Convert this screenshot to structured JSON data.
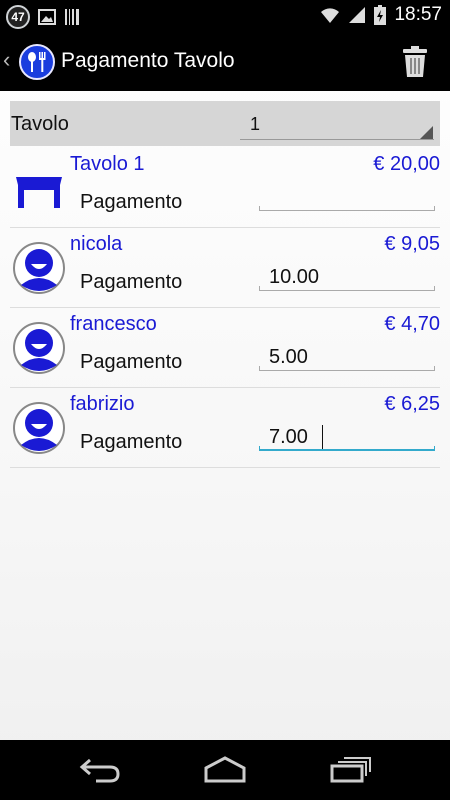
{
  "status_bar": {
    "notification_count": "47",
    "time": "18:57",
    "icons": [
      "image-icon",
      "barcode-icon",
      "wifi-icon",
      "signal-icon",
      "battery-icon"
    ]
  },
  "action_bar": {
    "title": "Pagamento Tavolo",
    "icons": [
      "back-chevron-icon",
      "restaurant-logo-icon",
      "trash-icon"
    ]
  },
  "table_selector": {
    "label": "Tavolo",
    "value": "1"
  },
  "rows": [
    {
      "name": "Tavolo 1",
      "amount": "€ 20,00",
      "pay_label": "Pagamento",
      "pay_value": "",
      "icon": "table-icon"
    },
    {
      "name": "nicola",
      "amount": "€ 9,05",
      "pay_label": "Pagamento",
      "pay_value": "10.00",
      "icon": "user-avatar-icon"
    },
    {
      "name": "francesco",
      "amount": "€ 4,70",
      "pay_label": "Pagamento",
      "pay_value": "5.00",
      "icon": "user-avatar-icon"
    },
    {
      "name": "fabrizio",
      "amount": "€ 6,25",
      "pay_label": "Pagamento",
      "pay_value": "7.00",
      "icon": "user-avatar-icon"
    }
  ],
  "colors": {
    "accent_blue": "#1a1ad4",
    "focus_underline": "#33aacc",
    "selector_bg": "#d6d6d6"
  },
  "nav_bar": {
    "icons": [
      "back-icon",
      "home-icon",
      "recent-apps-icon"
    ]
  }
}
